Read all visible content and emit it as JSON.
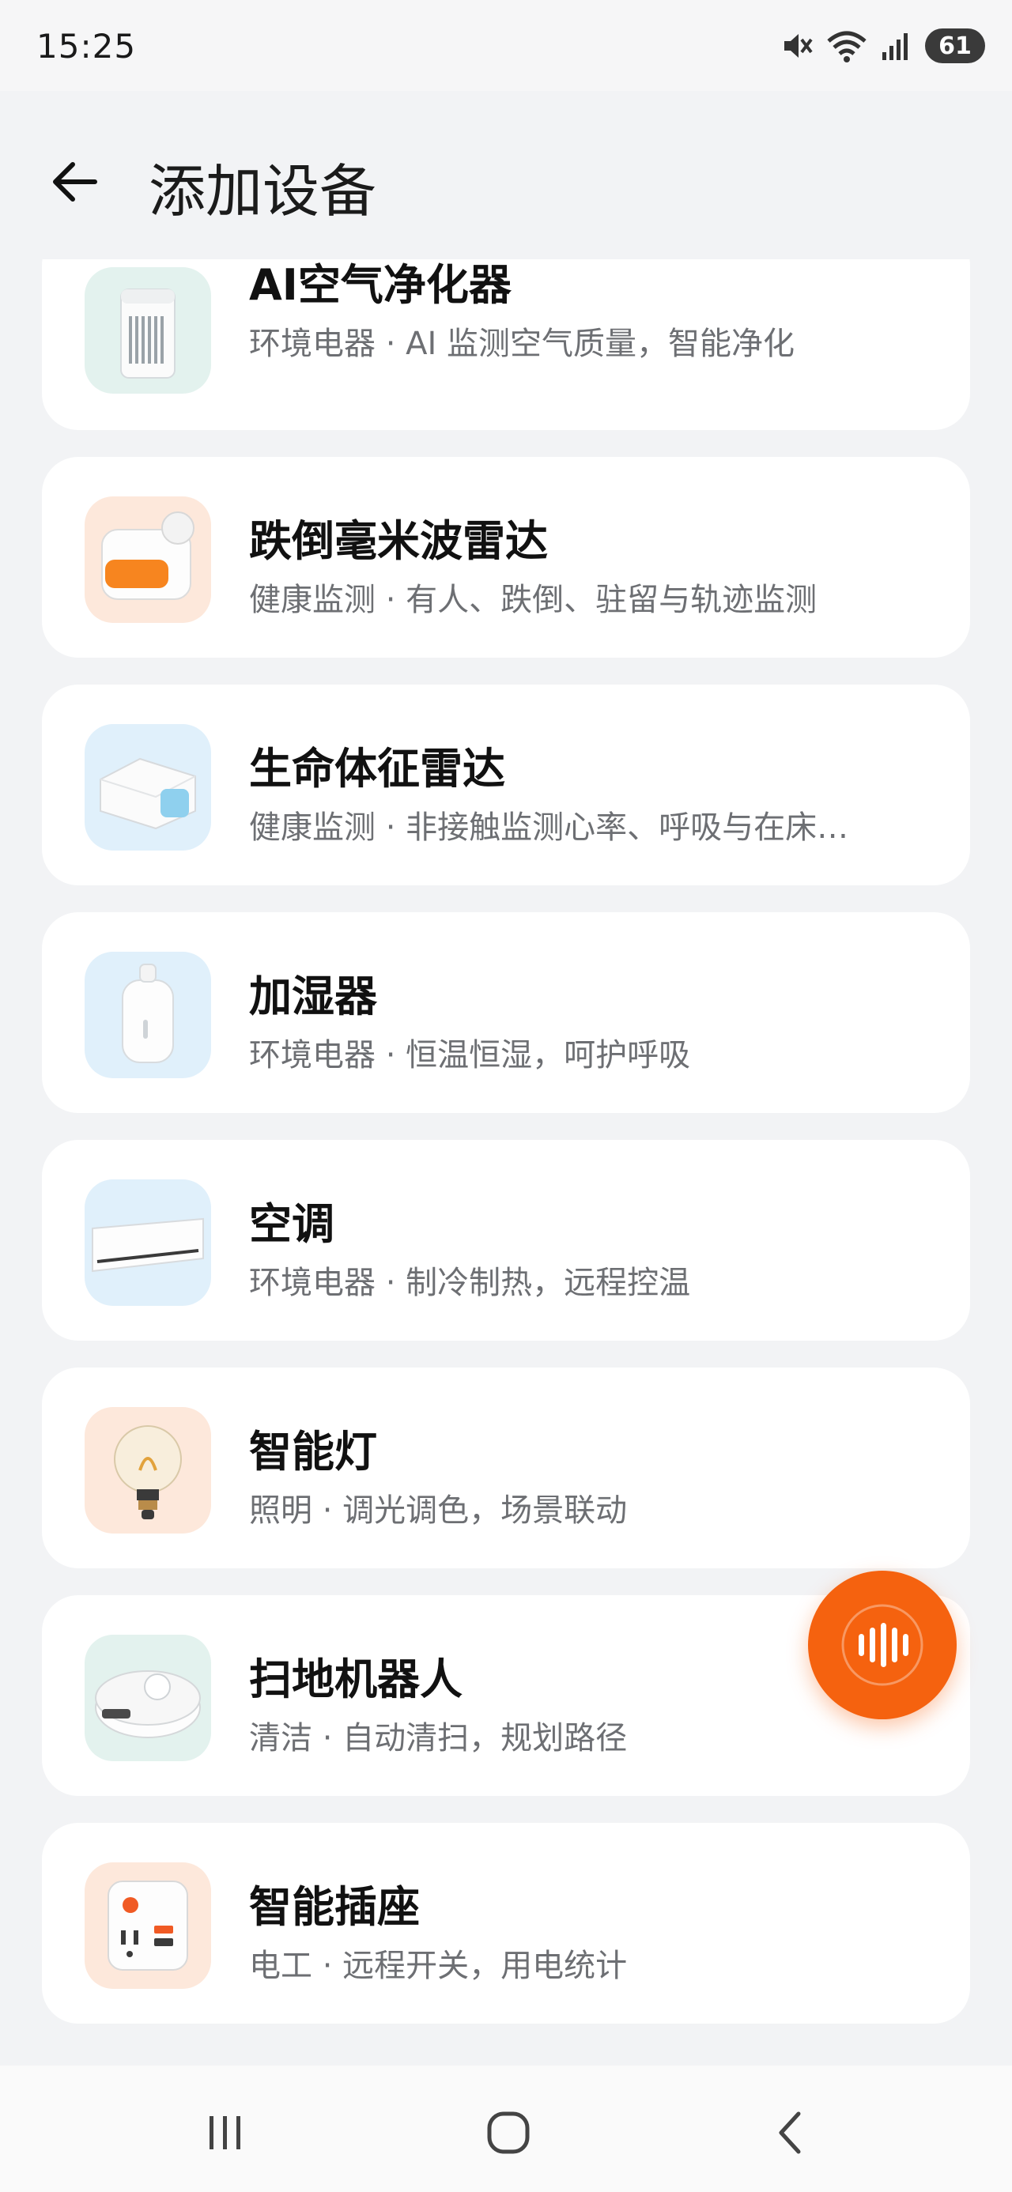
{
  "status_bar": {
    "time": "15:25",
    "battery": "61",
    "icons": [
      "mute-icon",
      "wifi-icon",
      "signal-icon",
      "battery-icon"
    ]
  },
  "header": {
    "title": "添加设备",
    "back_icon": "arrow-left-icon"
  },
  "devices": [
    {
      "title": "AI空气净化器",
      "desc": "环境电器 · AI 监测空气质量，智能净化",
      "thumb_bg": "#e3f2ee"
    },
    {
      "title": "跌倒毫米波雷达",
      "desc": "健康监测 · 有人、跌倒、驻留与轨迹监测",
      "thumb_bg": "#fde8db"
    },
    {
      "title": "生命体征雷达",
      "desc": "健康监测 · 非接触监测心率、呼吸与在床…",
      "thumb_bg": "#e0f0fb"
    },
    {
      "title": "加湿器",
      "desc": "环境电器 · 恒温恒湿，呵护呼吸",
      "thumb_bg": "#e0f0fb"
    },
    {
      "title": "空调",
      "desc": "环境电器 · 制冷制热，远程控温",
      "thumb_bg": "#e0f0fb"
    },
    {
      "title": "智能灯",
      "desc": "照明 · 调光调色，场景联动",
      "thumb_bg": "#fde8db"
    },
    {
      "title": "扫地机器人",
      "desc": "清洁 · 自动清扫，规划路径",
      "thumb_bg": "#e3f2ee"
    },
    {
      "title": "智能插座",
      "desc": "电工 · 远程开关，用电统计",
      "thumb_bg": "#fde8db"
    }
  ],
  "fab": {
    "icon": "voice-wave-icon",
    "color": "#f5620f"
  },
  "nav": {
    "icons": [
      "recents-icon",
      "home-icon",
      "back-icon"
    ]
  }
}
